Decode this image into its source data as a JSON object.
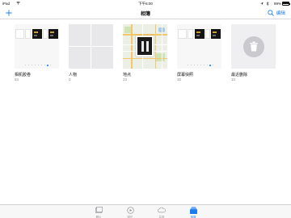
{
  "status_bar": {
    "carrier": "iPad",
    "time": "下午6:00",
    "battery": "89%",
    "battery_level": 0.89
  },
  "nav": {
    "title": "相簿",
    "edit_label": "编辑"
  },
  "albums": [
    {
      "name": "相机胶卷",
      "count": "53"
    },
    {
      "name": "人物",
      "count": "0"
    },
    {
      "name": "地点",
      "count": "23"
    },
    {
      "name": "屏幕快照",
      "count": "30"
    },
    {
      "name": "最近删除",
      "count": "10"
    }
  ],
  "tabs": [
    {
      "label": "照片",
      "icon": "photos-icon"
    },
    {
      "label": "回忆",
      "icon": "memories-icon"
    },
    {
      "label": "共享",
      "icon": "cloud-icon"
    },
    {
      "label": "相簿",
      "icon": "albums-icon",
      "active": true
    }
  ],
  "colors": {
    "accent": "#1a7cf0",
    "secondary_text": "#8e8e93"
  }
}
